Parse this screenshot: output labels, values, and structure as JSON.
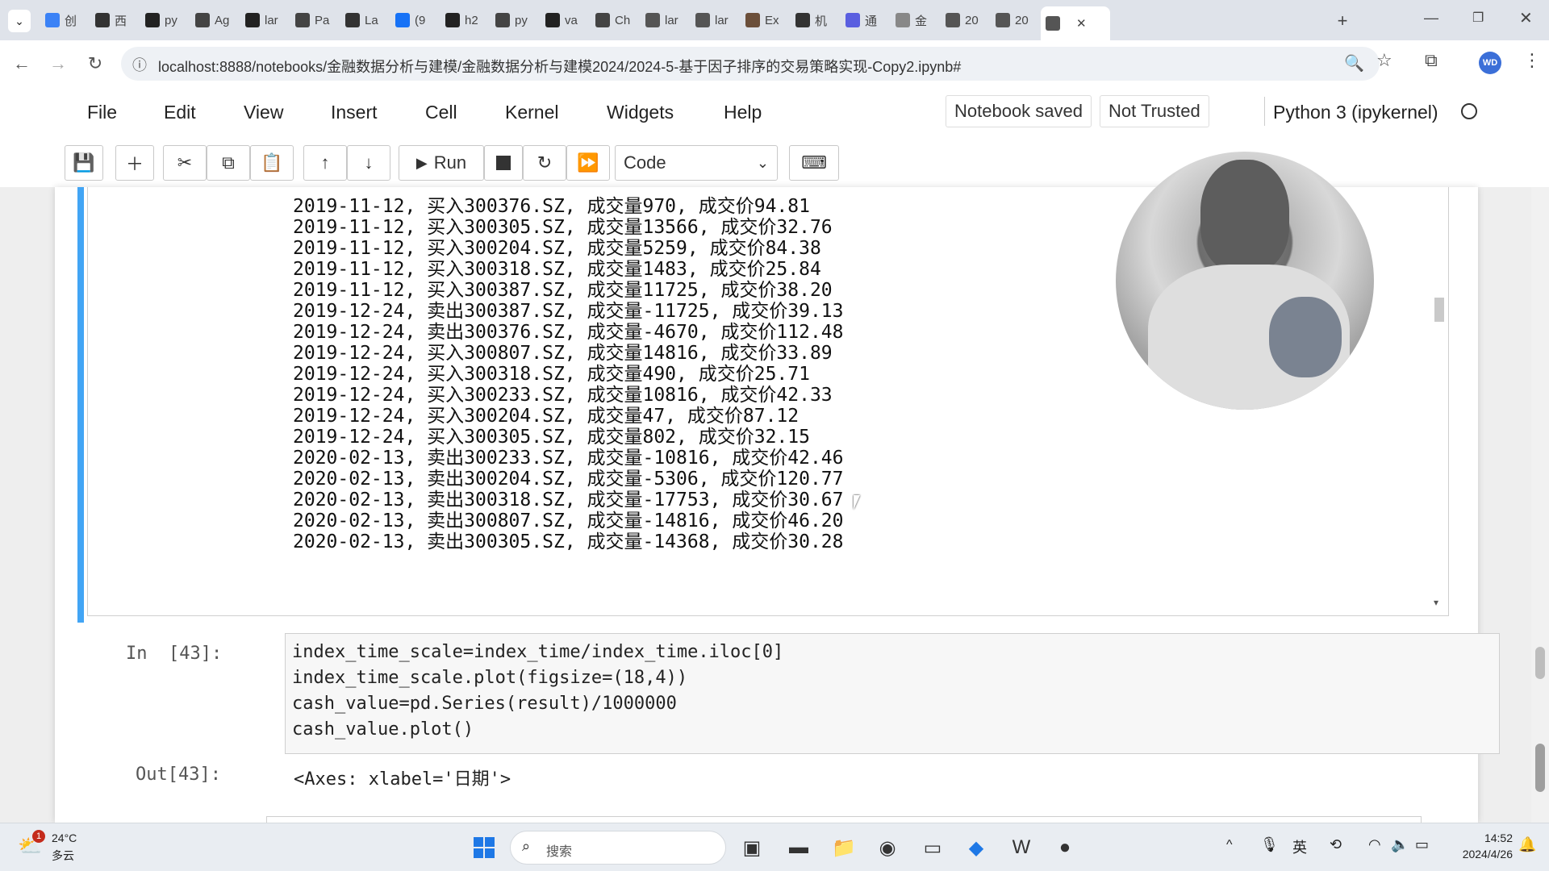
{
  "browser": {
    "tabs": [
      {
        "icon": "calendar-icon",
        "label": "创"
      },
      {
        "icon": "openai-icon",
        "label": "西"
      },
      {
        "icon": "github-icon",
        "label": "py"
      },
      {
        "icon": "mail-icon",
        "label": "Ag"
      },
      {
        "icon": "github-icon",
        "label": "lar"
      },
      {
        "icon": "mail-icon",
        "label": "Pa"
      },
      {
        "icon": "terminal-icon",
        "label": "La"
      },
      {
        "icon": "zhihu-icon",
        "label": "(9"
      },
      {
        "icon": "github-icon",
        "label": "h2"
      },
      {
        "icon": "c-icon",
        "label": "py"
      },
      {
        "icon": "github-icon",
        "label": "va"
      },
      {
        "icon": "mail-icon",
        "label": "Ch"
      },
      {
        "icon": "book-icon",
        "label": "lar"
      },
      {
        "icon": "book-icon",
        "label": "lar"
      },
      {
        "icon": "user-icon",
        "label": "Ex"
      },
      {
        "icon": "bracket-icon",
        "label": "机"
      },
      {
        "icon": "tongyi-icon",
        "label": "通"
      },
      {
        "icon": "loading-icon",
        "label": "金"
      },
      {
        "icon": "jupyter-icon",
        "label": "20"
      },
      {
        "icon": "jupyter-icon",
        "label": "20"
      },
      {
        "icon": "jupyter-icon",
        "label": ""
      }
    ],
    "url": "localhost:8888/notebooks/金融数据分析与建模/金融数据分析与建模2024/2024-5-基于因子排序的交易策略实现-Copy2.ipynb#",
    "profile": "WD"
  },
  "jupyter": {
    "menus": [
      "File",
      "Edit",
      "View",
      "Insert",
      "Cell",
      "Kernel",
      "Widgets",
      "Help"
    ],
    "status_saved": "Notebook saved",
    "status_trust": "Not Trusted",
    "kernel": "Python 3 (ipykernel)",
    "run_label": "Run",
    "cell_type": "Code"
  },
  "output_lines": [
    "2019-11-12, 买入300376.SZ, 成交量970, 成交价94.81",
    "2019-11-12, 买入300305.SZ, 成交量13566, 成交价32.76",
    "2019-11-12, 买入300204.SZ, 成交量5259, 成交价84.38",
    "2019-11-12, 买入300318.SZ, 成交量1483, 成交价25.84",
    "2019-11-12, 买入300387.SZ, 成交量11725, 成交价38.20",
    "2019-12-24, 卖出300387.SZ, 成交量-11725, 成交价39.13",
    "2019-12-24, 卖出300376.SZ, 成交量-4670, 成交价112.48",
    "2019-12-24, 买入300807.SZ, 成交量14816, 成交价33.89",
    "2019-12-24, 买入300318.SZ, 成交量490, 成交价25.71",
    "2019-12-24, 买入300233.SZ, 成交量10816, 成交价42.33",
    "2019-12-24, 买入300204.SZ, 成交量47, 成交价87.12",
    "2019-12-24, 买入300305.SZ, 成交量802, 成交价32.15",
    "2020-02-13, 卖出300233.SZ, 成交量-10816, 成交价42.46",
    "2020-02-13, 卖出300204.SZ, 成交量-5306, 成交价120.77",
    "2020-02-13, 卖出300318.SZ, 成交量-17753, 成交价30.67",
    "2020-02-13, 卖出300807.SZ, 成交量-14816, 成交价46.20",
    "2020-02-13, 卖出300305.SZ, 成交量-14368, 成交价30.28"
  ],
  "cell": {
    "in_prompt": "In  [43]:",
    "code": [
      "index_time_scale=index_time/index_time.iloc[0]",
      "index_time_scale.plot(figsize=(18,4))",
      "cash_value=pd.Series(result)/1000000",
      "cash_value.plot()"
    ],
    "out_prompt": "Out[43]:",
    "out_text": "<Axes: xlabel='日期'>"
  },
  "taskbar": {
    "weather_temp": "24°C",
    "weather_desc": "多云",
    "notification_count": "1",
    "search_placeholder": "搜索",
    "time": "14:52",
    "date": "2024/4/26"
  }
}
